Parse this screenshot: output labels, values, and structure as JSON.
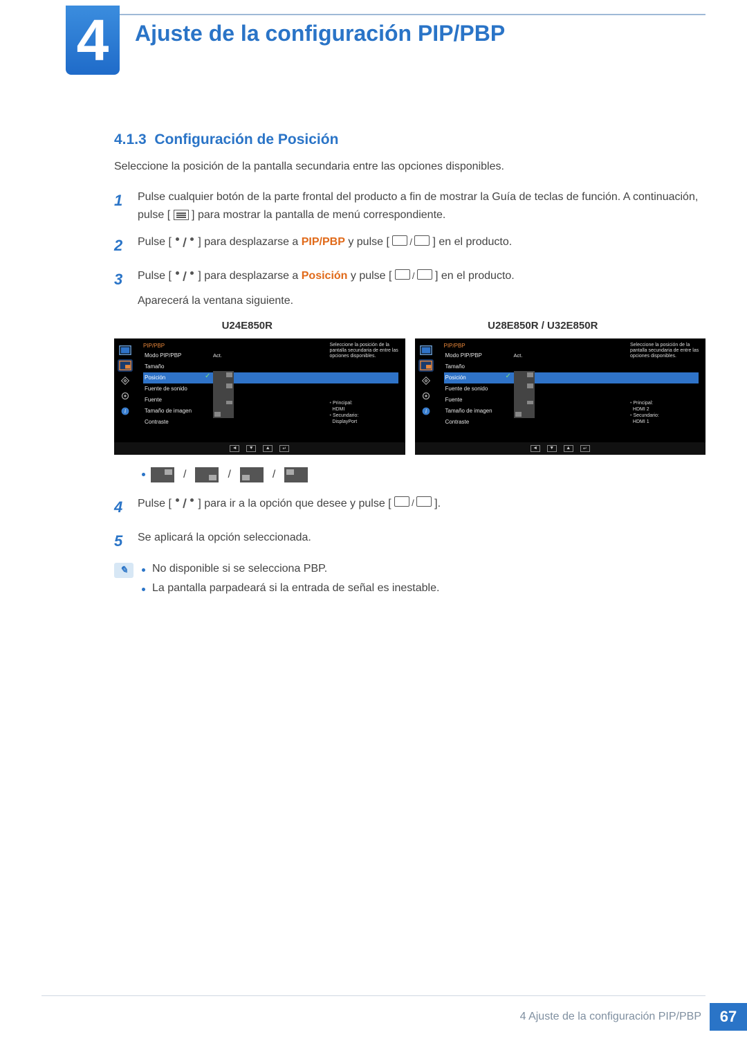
{
  "chapter": {
    "number": "4",
    "title": "Ajuste de la configuración PIP/PBP"
  },
  "section": {
    "number": "4.1.3",
    "title": "Configuración de Posición"
  },
  "intro": "Seleccione la posición de la pantalla secundaria entre las opciones disponibles.",
  "steps": {
    "s1": {
      "num": "1",
      "text_a": "Pulse cualquier botón de la parte frontal del producto a fin de mostrar la Guía de teclas de función. A continuación, pulse [",
      "text_b": "] para mostrar la pantalla de menú correspondiente."
    },
    "s2": {
      "num": "2",
      "text_a": "Pulse [",
      "text_b": "] para desplazarse a ",
      "kw": "PIP/PBP",
      "text_c": " y pulse [",
      "text_d": "] en el producto."
    },
    "s3": {
      "num": "3",
      "text_a": "Pulse [",
      "text_b": "] para desplazarse a ",
      "kw": "Posición",
      "text_c": " y pulse [",
      "text_d": "] en el producto.",
      "tail": "Aparecerá la ventana siguiente."
    },
    "s4": {
      "num": "4",
      "text_a": "Pulse [",
      "text_b": "] para ir a la opción que desee y pulse [",
      "text_c": "]."
    },
    "s5": {
      "num": "5",
      "text": "Se aplicará la opción seleccionada."
    }
  },
  "models": {
    "left": "U24E850R",
    "right": "U28E850R / U32E850R"
  },
  "osd": {
    "title": "PIP/PBP",
    "desc": "Seleccione la posición de la pantalla secundaria de entre las opciones disponibles.",
    "items": {
      "mode": {
        "label": "Modo PIP/PBP",
        "value": "Act."
      },
      "size": {
        "label": "Tamaño"
      },
      "position": {
        "label": "Posición"
      },
      "sound": {
        "label": "Fuente de sonido"
      },
      "source": {
        "label": "Fuente"
      },
      "imgsize": {
        "label": "Tamaño de imagen"
      },
      "contrast": {
        "label": "Contraste"
      }
    },
    "left_src": {
      "principal_label": "Principal:",
      "principal_val": "HDMI",
      "secondary_label": "Secundario:",
      "secondary_val": "DisplayPort"
    },
    "right_src": {
      "principal_label": "Principal:",
      "principal_val": "HDMI 2",
      "secondary_label": "Secundario:",
      "secondary_val": "HDMI 1"
    },
    "nav": {
      "left": "◄",
      "down": "▼",
      "up": "▲",
      "enter": "↵"
    }
  },
  "notes": {
    "n1": "No disponible si se selecciona PBP.",
    "n2": "La pantalla parpadeará si la entrada de señal es inestable."
  },
  "footer": {
    "text": "4 Ajuste de la configuración PIP/PBP",
    "page": "67"
  }
}
